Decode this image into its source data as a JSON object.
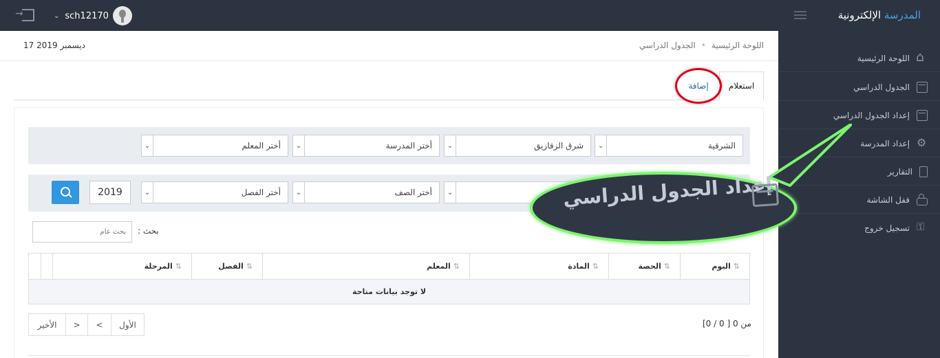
{
  "header": {
    "brand_part1": "المدرسة",
    "brand_part2": "الإلكترونية",
    "username": "sch12170"
  },
  "sidebar": {
    "items": [
      {
        "label": "اللوحة الرئيسية",
        "icon": "home-icon"
      },
      {
        "label": "الجدول الدراسي",
        "icon": "calendar-icon"
      },
      {
        "label": "إعداد الجدول الدراسي",
        "icon": "calendar-icon"
      },
      {
        "label": "إعداد المدرسة",
        "icon": "gear-icon"
      },
      {
        "label": "التقارير",
        "icon": "document-icon"
      },
      {
        "label": "قفل الشاشة",
        "icon": "lock-icon"
      },
      {
        "label": "تسجيل خروج",
        "icon": "key-icon"
      }
    ]
  },
  "breadcrumb": {
    "home": "اللوحة الرئيسية",
    "current": "الجدول الدراسي"
  },
  "date": "17 ديسمبر 2019",
  "tabs": {
    "inquiry": "استعلام",
    "add": "إضافة"
  },
  "filters": {
    "governorate": "الشرقية",
    "district": "شرق الزقازيق",
    "school": "أختر المدرسة",
    "teacher": "أختر المعلم",
    "grade": "أختر الصف",
    "class": "أختر الفصل",
    "year": "2019"
  },
  "search": {
    "label": "بحث :",
    "placeholder": "بحث عام"
  },
  "table": {
    "columns": [
      "اليوم",
      "الحصة",
      "المادة",
      "المعلم",
      "الفصل",
      "المرحلة"
    ],
    "empty_message": "لا توجد بيانات متاحة"
  },
  "pagination": {
    "info": "[0 / 0 ] من 0",
    "first": "الأول",
    "prev": "<",
    "next": ">",
    "last": "الأخير"
  },
  "callout": {
    "text": "إعداد الجدول الدراسي"
  },
  "colors": {
    "topbar": "#2c3441",
    "accent": "#3097e0",
    "highlight_circle": "#d9001b",
    "callout_border": "#7df46e"
  }
}
